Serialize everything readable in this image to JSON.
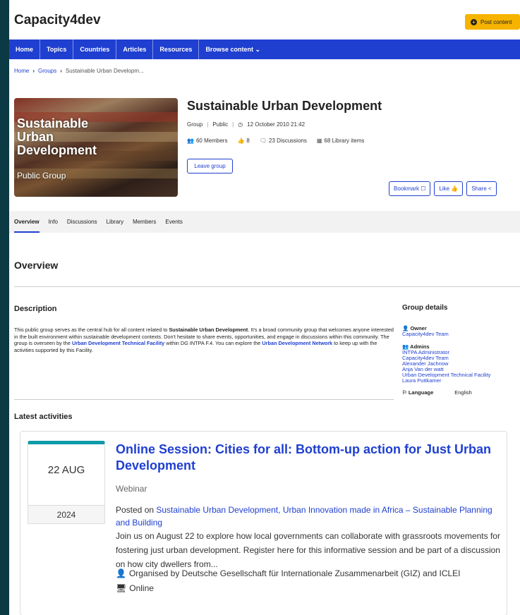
{
  "header": {
    "brand": "Capacity4dev",
    "post_button": "Post content"
  },
  "nav": {
    "items": [
      "Home",
      "Topics",
      "Countries",
      "Articles",
      "Resources",
      "Browse content"
    ]
  },
  "breadcrumb": {
    "home": "Home",
    "groups": "Groups",
    "current": "Sustainable Urban Developm..."
  },
  "group": {
    "image_title_1": "Sustainable",
    "image_title_2": "Urban",
    "image_title_3": "Development",
    "image_sub": "Public Group",
    "title": "Sustainable Urban Development",
    "type": "Group",
    "visibility": "Public",
    "created": "12 October 2010 21:42",
    "members": "60",
    "members_label": "Members",
    "likes": "8",
    "discussions": "23",
    "discussions_label": "Discussions",
    "library": "68",
    "library_label": "Library items",
    "leave_button": "Leave group",
    "bookmark_button": "Bookmark",
    "like_button": "Like",
    "share_button": "Share"
  },
  "tabs": [
    "Overview",
    "Info",
    "Discussions",
    "Library",
    "Members",
    "Events"
  ],
  "overview": {
    "heading": "Overview",
    "description_heading": "Description",
    "desc_1": "This public group serves as the central hub for all content related to ",
    "desc_bold": "Sustainable Urban Development",
    "desc_2": ". It's a broad community group that welcomes anyone interested in the built environment within sustainable development contexts. Don't hesitate to share events, opportunities, and engage in discussions within this community. The group is overseen by the ",
    "desc_link1": "Urban Development Technical Facility",
    "desc_3": " within DG INTPA F.4. You can explore the ",
    "desc_link2": "Urban Development Network",
    "desc_4": " to keep up with the activities supported by this Facility."
  },
  "group_details": {
    "heading": "Group details",
    "owner_label": "Owner",
    "owner": "Capacity4dev Team",
    "admins_label": "Admins",
    "admins": [
      "INTPA Administrator",
      "Capacity4dev Team",
      "Alexander Jachnow",
      "Anja Van der watt",
      "Urban Development Technical Facility",
      "Laura Puttkamer"
    ],
    "language_label": "Language",
    "language": "English"
  },
  "activities": {
    "heading": "Latest activities",
    "event": {
      "day_month": "22 AUG",
      "year": "2024",
      "title": "Online Session: Cities for all: Bottom-up action for Just Urban Development",
      "type": "Webinar",
      "posted_prefix": "Posted on ",
      "posted_links": "Sustainable Urban Development,  Urban Innovation made in Africa – Sustainable Planning and Building",
      "body": "Join us on August 22 to explore how local governments can collaborate with grassroots movements for fostering just urban development. Register here for this informative session and be part of a discussion on how city dwellers from...",
      "organiser": "Organised by Deutsche Gesellschaft für Internationale Zusammenarbeit (GIZ) and ICLEI",
      "location": "Online"
    }
  }
}
